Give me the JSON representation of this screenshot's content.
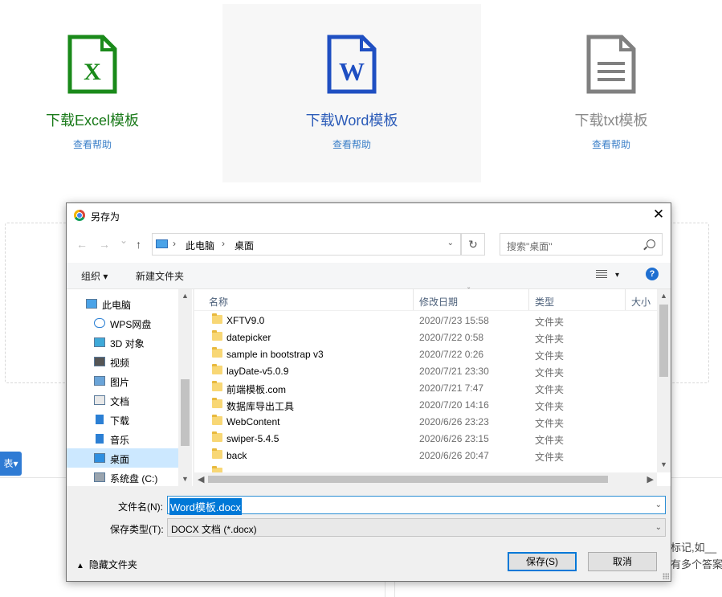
{
  "cards": {
    "excel": {
      "title": "下载Excel模板",
      "help": "查看帮助",
      "icon": "excel-file-icon",
      "color": "#1a7a1a"
    },
    "word": {
      "title": "下载Word模板",
      "help": "查看帮助",
      "icon": "word-file-icon",
      "color": "#2b5bb8"
    },
    "txt": {
      "title": "下载txt模板",
      "help": "查看帮助",
      "icon": "text-file-icon",
      "color": "#8a8a8a"
    }
  },
  "background": {
    "blue_button_label": "表",
    "side_text_1": "标记,如__",
    "side_text_2": "有多个答案"
  },
  "dialog": {
    "title": "另存为",
    "close": "✕",
    "nav": {
      "back": "←",
      "forward": "→",
      "recent": "⌄",
      "up": "↑",
      "refresh": "↻"
    },
    "address": {
      "segments": [
        "此电脑",
        "桌面"
      ],
      "sep": "›"
    },
    "search_placeholder": "搜索\"桌面\"",
    "toolbar": {
      "organize": "组织 ▾",
      "new_folder": "新建文件夹",
      "view_dd": "▾",
      "help": "?"
    },
    "nav_items": [
      {
        "label": "此电脑",
        "icon": "computer-icon"
      },
      {
        "label": "WPS网盘",
        "icon": "cloud-icon"
      },
      {
        "label": "3D 对象",
        "icon": "cube-icon"
      },
      {
        "label": "视频",
        "icon": "video-icon"
      },
      {
        "label": "图片",
        "icon": "picture-icon"
      },
      {
        "label": "文档",
        "icon": "document-icon"
      },
      {
        "label": "下载",
        "icon": "download-icon"
      },
      {
        "label": "音乐",
        "icon": "music-icon"
      },
      {
        "label": "桌面",
        "icon": "desktop-icon",
        "selected": true
      },
      {
        "label": "系统盘 (C:)",
        "icon": "drive-icon"
      }
    ],
    "columns": {
      "name": "名称",
      "date": "修改日期",
      "type": "类型",
      "size": "大小"
    },
    "files": [
      {
        "name": "XFTV9.0",
        "date": "2020/7/23 15:58",
        "type": "文件夹"
      },
      {
        "name": "datepicker",
        "date": "2020/7/22 0:58",
        "type": "文件夹"
      },
      {
        "name": "sample in bootstrap v3",
        "date": "2020/7/22 0:26",
        "type": "文件夹"
      },
      {
        "name": "layDate-v5.0.9",
        "date": "2020/7/21 23:30",
        "type": "文件夹"
      },
      {
        "name": "前端模板.com",
        "date": "2020/7/21 7:47",
        "type": "文件夹"
      },
      {
        "name": "数据库导出工具",
        "date": "2020/7/20 14:16",
        "type": "文件夹"
      },
      {
        "name": "WebContent",
        "date": "2020/6/26 23:23",
        "type": "文件夹"
      },
      {
        "name": "swiper-5.4.5",
        "date": "2020/6/26 23:15",
        "type": "文件夹"
      },
      {
        "name": "back",
        "date": "2020/6/26 20:47",
        "type": "文件夹"
      }
    ],
    "filename_label": "文件名(N):",
    "filename_value": "Word模板.docx",
    "filetype_label": "保存类型(T):",
    "filetype_value": "DOCX 文档 (*.docx)",
    "hide_folders": "隐藏文件夹",
    "save": "保存(S)",
    "cancel": "取消"
  }
}
